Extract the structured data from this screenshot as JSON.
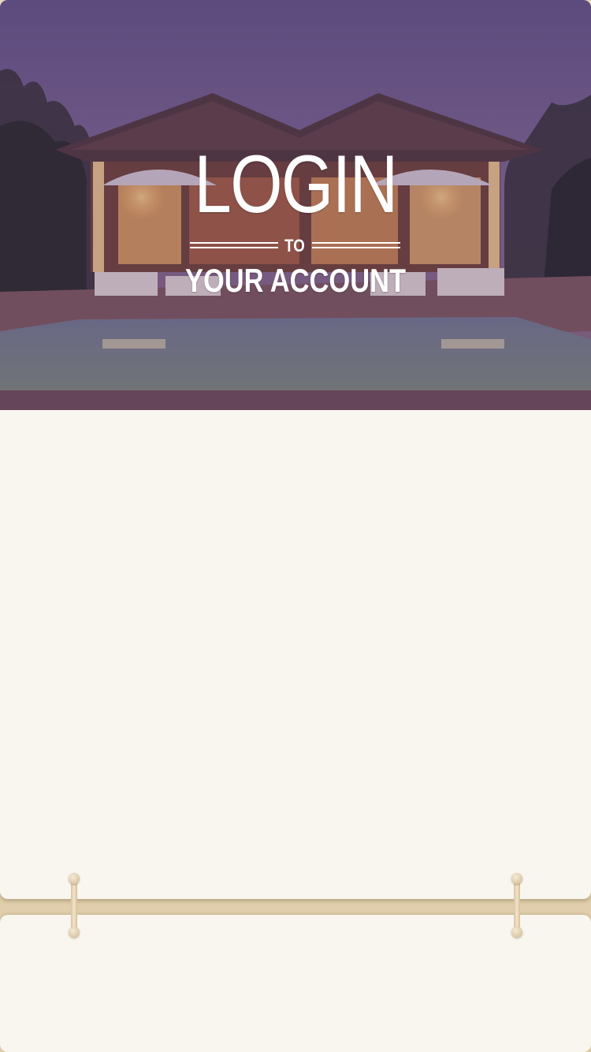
{
  "login": {
    "title": "LOGIN",
    "connector": "TO",
    "subtitle": "YOUR ACCOUNT"
  },
  "colors": {
    "card_background": "#f9f6ef",
    "page_background": "#e3d3b5",
    "hero_tint": "#5d4d7e",
    "title_text": "#ffffff"
  },
  "icons": {
    "left_ring": "ring-hinge-icon",
    "right_ring": "ring-hinge-icon"
  }
}
